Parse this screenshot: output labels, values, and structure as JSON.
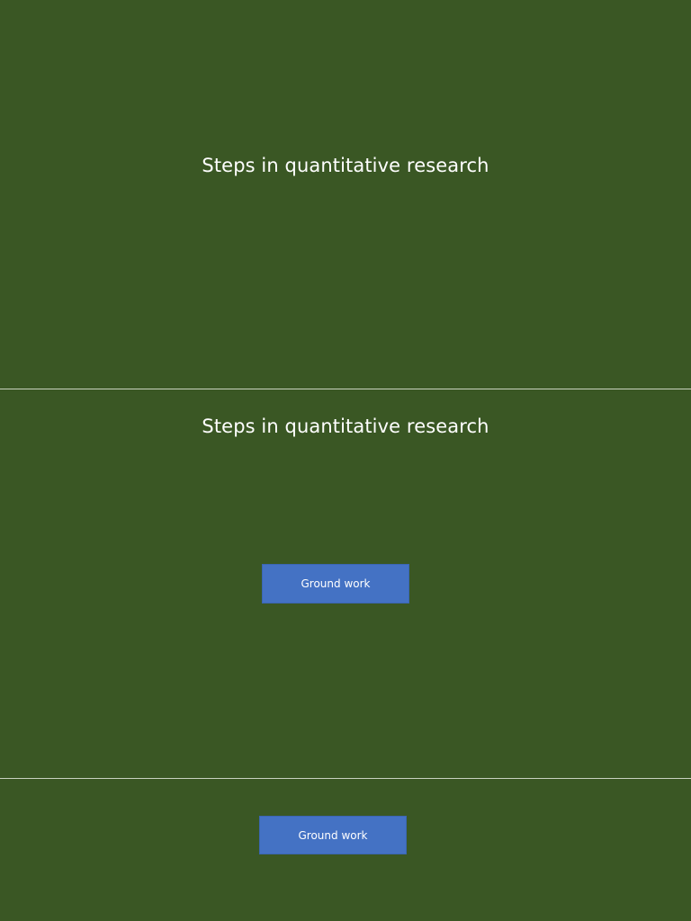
{
  "slides": [
    {
      "title": "Steps in quantitative research"
    },
    {
      "title": "Steps in quantitative research",
      "step_label": "Ground work"
    },
    {
      "step_label": "Ground work"
    }
  ],
  "colors": {
    "slide_background": "#3a5724",
    "step_box": "#4472c4",
    "title_text": "#ffffff"
  }
}
